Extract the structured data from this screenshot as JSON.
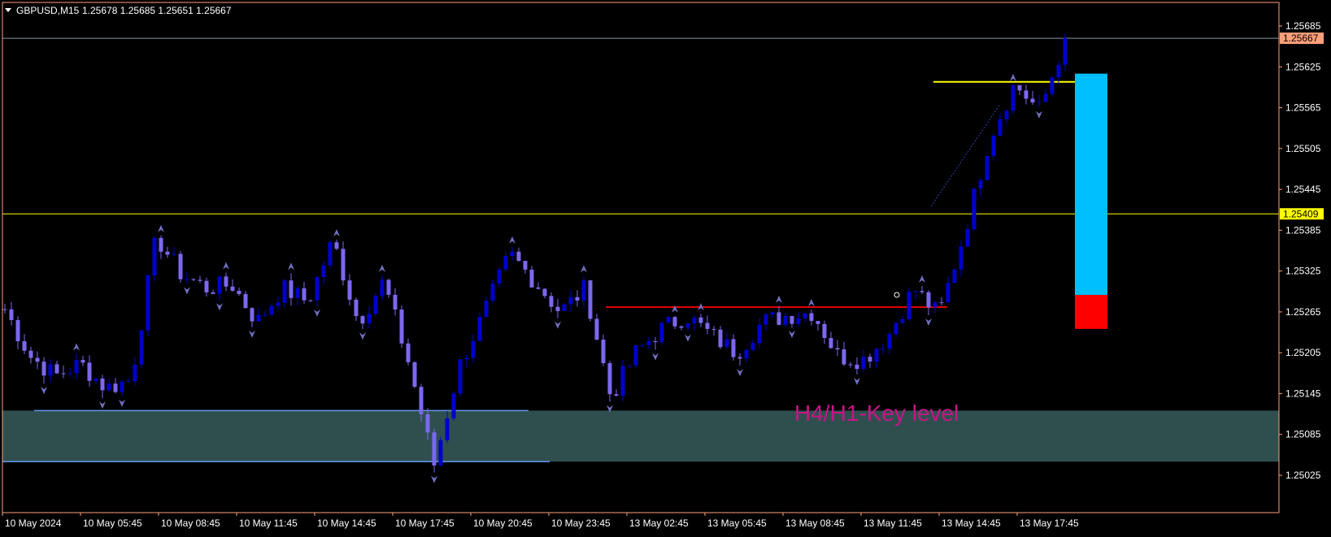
{
  "header": {
    "symbol_timeframe": "GBPUSD,M15",
    "ohlc_values": "1.25678 1.25685 1.25651 1.25667"
  },
  "colors": {
    "background": "#000000",
    "frame": "#FFA07A",
    "text": "#FFFFFF",
    "bull_candle": "#0000CD",
    "bear_candle": "#7B68EE",
    "fractal_arrow": "#7070C0",
    "key_level_zone": "#2F4F4F",
    "key_level_line": "#6495ED",
    "key_level_text": "#C71585",
    "yellow_level": "#FFFF00",
    "price_line": "#8899AA",
    "red_level": "#E00000",
    "target_box": "#00BFFF",
    "stop_box": "#FF0000"
  },
  "annotation": {
    "key_level_label": "H4/H1-Key level"
  },
  "price_tags": {
    "current_price": "1.25667",
    "yellow_level": "1.25409"
  },
  "chart_data": {
    "type": "candlestick",
    "title": "GBPUSD,M15",
    "ylim": [
      1.25,
      1.2573
    ],
    "y_ticks": [
      "1.25685",
      "1.25625",
      "1.25565",
      "1.25505",
      "1.25445",
      "1.25385",
      "1.25325",
      "1.25265",
      "1.25205",
      "1.25145",
      "1.25085",
      "1.25025"
    ],
    "x_ticks": [
      "10 May 2024",
      "10 May 05:45",
      "10 May 08:45",
      "10 May 11:45",
      "10 May 14:45",
      "10 May 17:45",
      "10 May 20:45",
      "10 May 23:45",
      "13 May 02:45",
      "13 May 05:45",
      "13 May 08:45",
      "13 May 11:45",
      "13 May 14:45",
      "13 May 17:45"
    ],
    "bars_per_tick": 12,
    "total_bars": 164,
    "ohlc_sample": [
      1.25269,
      1.252,
      1.25171,
      1.25189,
      1.25153,
      1.25165,
      1.25375,
      1.2532,
      1.253,
      1.25305,
      1.2525,
      1.253,
      1.2528,
      1.2537,
      1.2525,
      1.2531,
      1.2519,
      1.2504,
      1.25185,
      1.25265,
      1.2535,
      1.2531,
      1.25265,
      1.253,
      1.2514,
      1.25205,
      1.2524,
      1.2526,
      1.2523,
      1.25205,
      1.2525,
      1.2526,
      1.25265,
      1.252,
      1.25195,
      1.2523,
      1.253,
      1.2526,
      1.2538,
      1.2552,
      1.256,
      1.2556,
      1.25667
    ],
    "horizontal_levels": [
      {
        "name": "current-price",
        "price": 1.25667
      },
      {
        "name": "yellow-level",
        "price": 1.25409
      },
      {
        "name": "red-level",
        "price": 1.25272
      },
      {
        "name": "yellow-target-line",
        "price": 1.25603
      }
    ],
    "key_level_zone": {
      "top": 1.2512,
      "bottom": 1.25045
    },
    "target_box": {
      "top": 1.25615,
      "bottom": 1.2529
    },
    "stop_box": {
      "top": 1.2529,
      "bottom": 1.2524
    }
  }
}
